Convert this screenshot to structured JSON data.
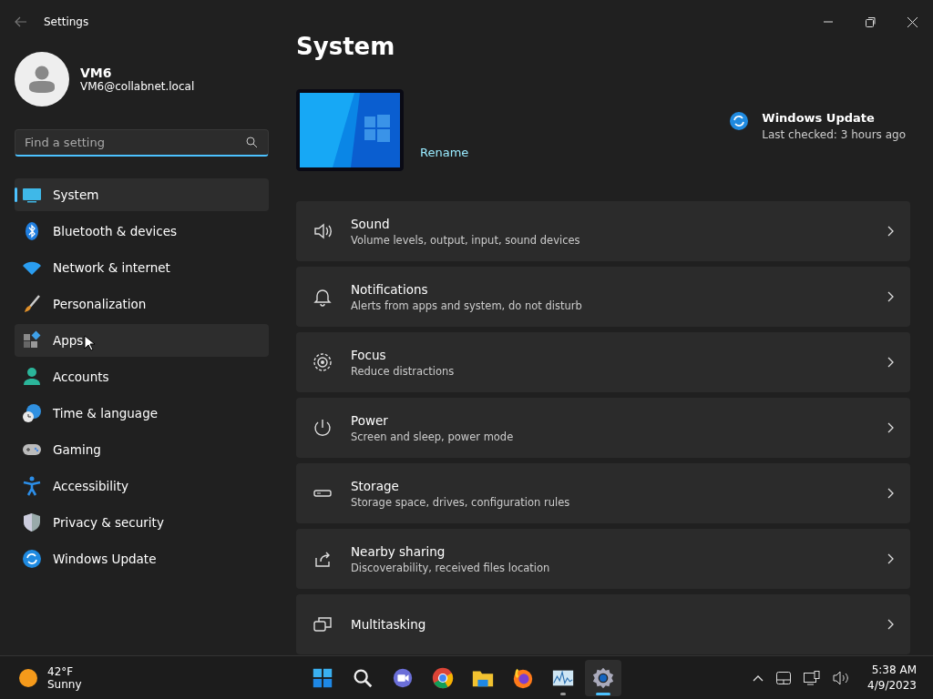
{
  "window": {
    "title": "Settings"
  },
  "profile": {
    "name": "VM6",
    "email": "VM6@collabnet.local"
  },
  "search": {
    "placeholder": "Find a setting"
  },
  "sidebar": {
    "items": [
      {
        "label": "System",
        "selected": true,
        "hovered": false
      },
      {
        "label": "Bluetooth & devices",
        "selected": false,
        "hovered": false
      },
      {
        "label": "Network & internet",
        "selected": false,
        "hovered": false
      },
      {
        "label": "Personalization",
        "selected": false,
        "hovered": false
      },
      {
        "label": "Apps",
        "selected": false,
        "hovered": true
      },
      {
        "label": "Accounts",
        "selected": false,
        "hovered": false
      },
      {
        "label": "Time & language",
        "selected": false,
        "hovered": false
      },
      {
        "label": "Gaming",
        "selected": false,
        "hovered": false
      },
      {
        "label": "Accessibility",
        "selected": false,
        "hovered": false
      },
      {
        "label": "Privacy & security",
        "selected": false,
        "hovered": false
      },
      {
        "label": "Windows Update",
        "selected": false,
        "hovered": false
      }
    ]
  },
  "page": {
    "title": "System",
    "rename_link": "Rename",
    "update": {
      "title": "Windows Update",
      "status": "Last checked: 3 hours ago"
    },
    "cards": [
      {
        "title": "Sound",
        "subtitle": "Volume levels, output, input, sound devices"
      },
      {
        "title": "Notifications",
        "subtitle": "Alerts from apps and system, do not disturb"
      },
      {
        "title": "Focus",
        "subtitle": "Reduce distractions"
      },
      {
        "title": "Power",
        "subtitle": "Screen and sleep, power mode"
      },
      {
        "title": "Storage",
        "subtitle": "Storage space, drives, configuration rules"
      },
      {
        "title": "Nearby sharing",
        "subtitle": "Discoverability, received files location"
      },
      {
        "title": "Multitasking"
      }
    ]
  },
  "taskbar": {
    "weather": {
      "temperature": "42°F",
      "condition": "Sunny"
    },
    "apps": [
      {
        "running": false,
        "active": false
      },
      {
        "running": false,
        "active": false
      },
      {
        "running": false,
        "active": false
      },
      {
        "running": false,
        "active": false
      },
      {
        "running": false,
        "active": false
      },
      {
        "running": false,
        "active": false
      },
      {
        "running": true,
        "active": false
      },
      {
        "running": true,
        "active": true
      }
    ],
    "clock": {
      "time": "5:38 AM",
      "date": "4/9/2023"
    }
  }
}
